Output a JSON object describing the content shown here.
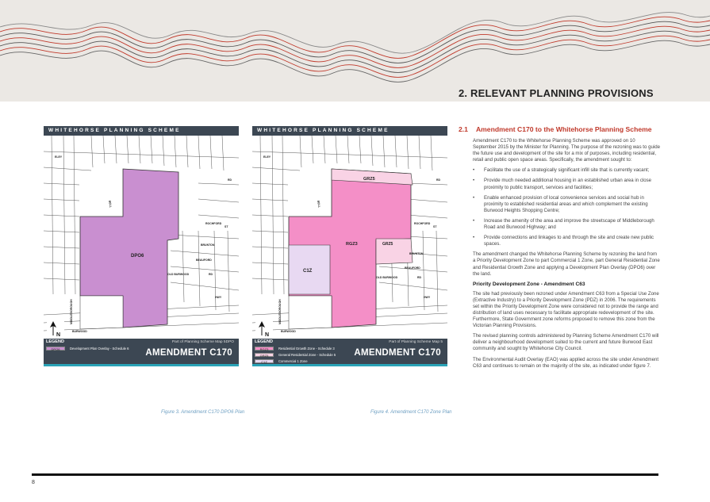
{
  "header": {
    "section_title": "2.   RELEVANT PLANNING PROVISIONS"
  },
  "maps": [
    {
      "top_title": "WHITEHORSE PLANNING SCHEME",
      "zone_label": "DPO6",
      "streets": [
        "ELEY",
        "RD",
        "BELL",
        "ROCHFORD",
        "BRUNTON",
        "ST",
        "BEAUFORD",
        "OLD BURWOOD",
        "RD",
        "MIDDLEBOROUGH",
        "HWY",
        "BURWOOD"
      ],
      "legend_label": "LEGEND",
      "map_ref": "Part of Planning Scheme Map 5DPO",
      "amendment": "AMENDMENT C170",
      "north": "N",
      "legend_items": [
        {
          "code": "DPO6",
          "text": "Development Plan Overlay - Schedule 6",
          "color": "#c98fd0"
        }
      ],
      "caption": "Figure 3. Amendment C170 DPO6 Plan"
    },
    {
      "top_title": "WHITEHORSE PLANNING SCHEME",
      "zone_labels": [
        "GRZ5",
        "RGZ3",
        "GRZ5",
        "C1Z"
      ],
      "streets": [
        "ELEY",
        "RD",
        "BELL",
        "ROCHFORD",
        "BRUNTON",
        "ST",
        "BEAUFORD",
        "OLD BURWOOD",
        "RD",
        "MIDDLEBOROUGH",
        "HWY",
        "BURWOOD"
      ],
      "legend_label": "LEGEND",
      "map_ref": "Part of Planning Scheme Map 5",
      "amendment": "AMENDMENT C170",
      "north": "N",
      "legend_items": [
        {
          "code": "RGZ3",
          "text": "Residential Growth Zone - Schedule 3",
          "color": "#f48fc7"
        },
        {
          "code": "GRZ5",
          "text": "General Residential Zone - Schedule 5",
          "color": "#f9d3e5"
        },
        {
          "code": "C1Z",
          "text": "Commercial 1 Zone",
          "color": "#e8d9f2"
        }
      ],
      "caption": "Figure 4. Amendment C170  Zone Plan"
    }
  ],
  "content": {
    "heading_num": "2.1",
    "heading_text": "Amendment C170 to the Whitehorse Planning Scheme",
    "para1": "Amendment C170 to the Whitehorse Planning Scheme was approved on 10 September 2015 by the Minister for Planning. The purpose of the rezoning was to guide the future use and development of the site for a mix of purposes, including residential, retail and public open space areas. Specifically, the amendment sought to:",
    "bullets": [
      "Facilitate the use of a strategically significant infill site that is currently vacant;",
      "Provide much needed additional housing in an established urban area in close proximity to public transport, services and facilities;",
      "Enable enhanced provision of local convenience services and social hub in proximity to established residential areas and which complement the existing Burwood Heights Shopping Centre;",
      "Increase the amenity of the area and improve the streetscape of Middleborough Road and Burwood Highway; and",
      "Provide connections and linkages to and through the site and create new public spaces."
    ],
    "para2": "The amendment changed the Whitehorse Planning Scheme by rezoning the land from a Priority Development Zone to part Commercial 1 Zone, part General Residential Zone and Residential Growth Zone and applying a Development Plan Overlay (DPO6) over the land.",
    "subheading": "Priority Development Zone -  Amendment C63",
    "para3": "The site had previously been rezoned under Amendment C63  from a Special Use Zone (Extractive Industry) to a Priority Development Zone (PDZ) in 2006. The requirements set within the Priority Development Zone were considered not to provide the range and distribution of land uses necessary to facilitate appropriate redevelopment of the site. Furthermore, State Government zone reforms proposed to remove this zone from the Victorian Planning Provisions.",
    "para4": "The revised planning controls administered by Planning Scheme Amendment C170 will deliver a neighbourhood development suited to the current and future Burwood East community and sought by Whitehorse City Council.",
    "para5": "The Environmental Audit Overlay (EAO) was applied across the site under Amendment C63 and continues to remain on the majority of the site, as indicated under figure 7."
  },
  "footer": {
    "page_number": "8"
  },
  "colors": {
    "accent": "#c0392b",
    "panel": "#3c4753",
    "strip": "#2aa3b7",
    "dpo6": "#c98fd0",
    "rgz3": "#f48fc7",
    "grz5": "#f9d3e5",
    "c1z": "#e8d9f2"
  }
}
